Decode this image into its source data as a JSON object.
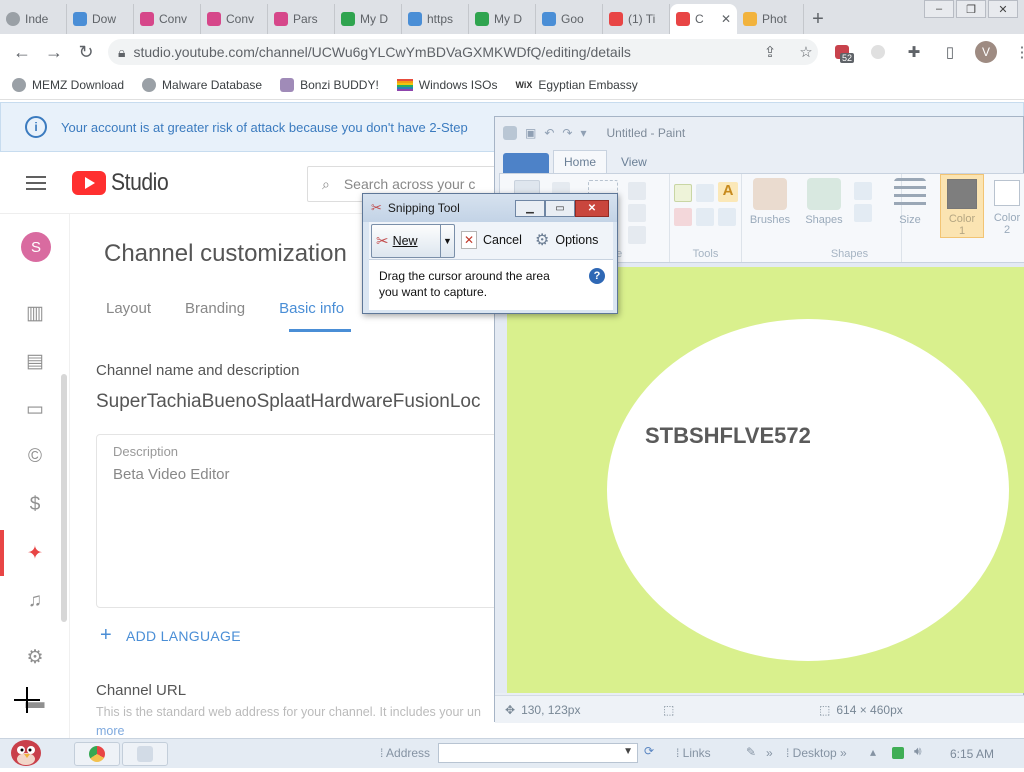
{
  "browser": {
    "tabs": [
      {
        "label": "Inde",
        "color": "#9aa0a6"
      },
      {
        "label": "Dow",
        "color": "#4a8ed6"
      },
      {
        "label": "Conv",
        "color": "#d6478a"
      },
      {
        "label": "Conv",
        "color": "#d6478a"
      },
      {
        "label": "Pars",
        "color": "#d6478a"
      },
      {
        "label": "My D",
        "color": "#2fa44f"
      },
      {
        "label": "https",
        "color": "#4a8ed6"
      },
      {
        "label": "My D",
        "color": "#2fa44f"
      },
      {
        "label": "Goo",
        "color": "#4a8ed6"
      },
      {
        "label": "(1) Ti",
        "color": "#e84545"
      },
      {
        "label": "C",
        "color": "#e84545",
        "active": true
      },
      {
        "label": "Phot",
        "color": "#f2b33d"
      }
    ],
    "new_tab_symbol": "+",
    "address": "studio.youtube.com/channel/UCWu6gYLCwYmBDVaGXMKWDfQ/editing/details",
    "extension_badge": "52",
    "profile_initial": "V",
    "bookmarks": [
      {
        "label": "MEMZ Download",
        "icon": "globe-icon"
      },
      {
        "label": "Malware Database",
        "icon": "globe-icon"
      },
      {
        "label": "Bonzi BUDDY!",
        "icon": "bonzi-icon"
      },
      {
        "label": "Windows ISOs",
        "icon": "rainbow-flag-icon"
      },
      {
        "label": "Egyptian Embassy",
        "icon": "wix-icon"
      }
    ],
    "wix_mark": "WiX"
  },
  "banner": {
    "text": "Your account is at greater risk of attack because you don't have 2-Step",
    "info_glyph": "i"
  },
  "studio": {
    "logo_text": "Studio",
    "search_placeholder": "Search across your c",
    "avatar_initial": "S",
    "page_title": "Channel customization",
    "tabs": [
      "Layout",
      "Branding",
      "Basic info"
    ],
    "selected_tab": "Basic info",
    "section_heading": "Channel name and description",
    "channel_name": "SuperTachiaBuenoSplaatHardwareFusionLoc",
    "description_label": "Description",
    "description_value": "Beta Video Editor",
    "add_language": "ADD LANGUAGE",
    "url_heading": "Channel URL",
    "url_description": "This is the standard web address for your channel. It includes your un",
    "learn_more": "more"
  },
  "paint": {
    "title": "Untitled - Paint",
    "tabs": [
      "Home",
      "View"
    ],
    "groups": {
      "image": "ge",
      "tools": "Tools",
      "shapes": "Shapes"
    },
    "brushes_label": "Brushes",
    "shapes_label": "Shapes",
    "size_label": "Size",
    "color1_label": "Color",
    "color1_num": "1",
    "color2_label": "Color",
    "color2_num": "2",
    "canvas_color": "#d9f08d",
    "canvas_text": "STBSHFLVE572",
    "status_cursor": "130, 123px",
    "status_size": "614 × 460px"
  },
  "snipping_tool": {
    "title": "Snipping Tool",
    "new_label": "New",
    "cancel_label": "Cancel",
    "options_label": "Options",
    "message": "Drag the cursor around the area you want to capture.",
    "help_glyph": "?"
  },
  "taskbar": {
    "address_label": "Address",
    "links_label": "Links",
    "desktop_label": "Desktop",
    "time": "6:15 AM"
  }
}
